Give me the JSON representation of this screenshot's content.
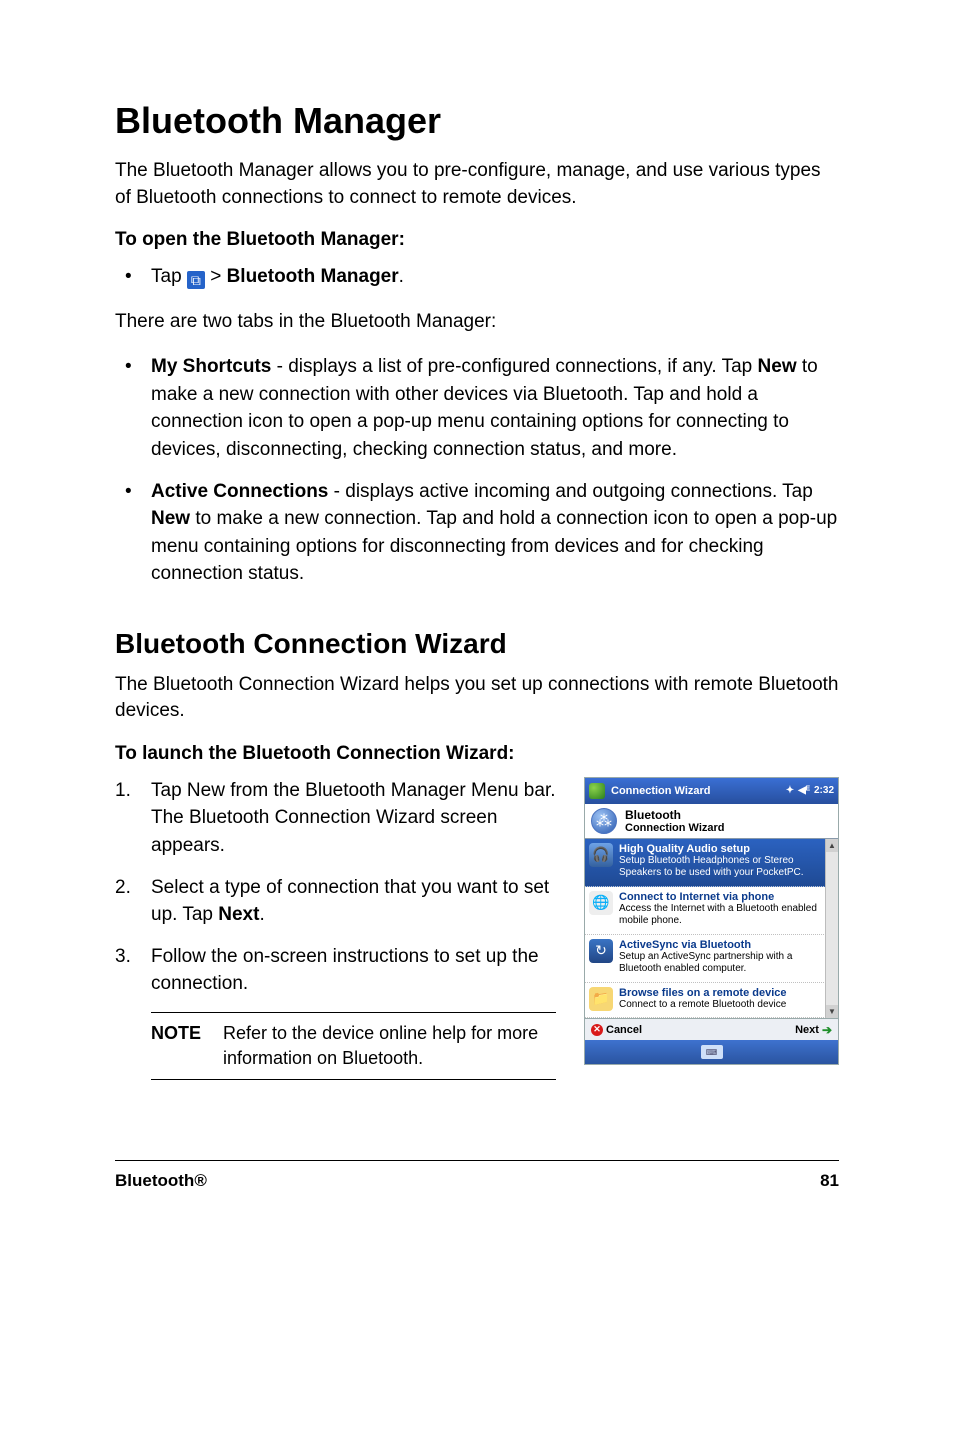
{
  "h1": "Bluetooth Manager",
  "intro1": "The Bluetooth Manager allows you to pre-configure, manage, and use various types of Bluetooth connections to connect to remote devices.",
  "open_head": "To open the Bluetooth Manager:",
  "open_step_pre": "Tap ",
  "open_step_post": " > ",
  "open_step_bold": "Bluetooth Manager",
  "open_step_period": ".",
  "two_tabs_intro": "There are two tabs in the Bluetooth Manager:",
  "tab1_bold": "My Shortcuts",
  "tab1_text_a": " - displays a list of pre-configured connections, if any. Tap ",
  "tab1_text_new": "New",
  "tab1_text_b": " to make a new connection with other devices via Bluetooth. Tap and hold a connection icon to open a pop-up menu containing options for connecting to devices, disconnecting, checking connection status, and more.",
  "tab2_bold": "Active Connections",
  "tab2_text_a": " - displays active incoming and outgoing connections. Tap ",
  "tab2_text_new": "New",
  "tab2_text_b": " to make a new connection. Tap and hold a connection icon to open a pop-up menu containing options for disconnecting from devices and for checking connection status.",
  "h2": "Bluetooth Connection Wizard",
  "intro2": "The Bluetooth Connection Wizard helps you set up connections with remote Bluetooth devices.",
  "launch_head": "To launch the Bluetooth Connection Wizard:",
  "step1": "Tap New from the Bluetooth Manager Menu bar. The Bluetooth Connection Wizard screen appears.",
  "step2_a": "Select a type of connection that you want to set up. Tap ",
  "step2_next": "Next",
  "step2_b": ".",
  "step3": "Follow the on-screen instructions to set up the connection.",
  "note_label": "NOTE",
  "note_body": "Refer to the device online help for more information on Bluetooth.",
  "footer_left": "Bluetooth®",
  "footer_right": "81",
  "device": {
    "titlebar": "Connection Wizard",
    "time": "2:32",
    "header1": "Bluetooth",
    "header2": "Connection Wizard",
    "items": [
      {
        "icon": "audio",
        "t1": "High Quality Audio setup",
        "t2": "Setup Bluetooth Headphones or Stereo Speakers to be used with your PocketPC.",
        "selected": true
      },
      {
        "icon": "globe",
        "t1": "Connect to Internet via phone",
        "t2": "Access the Internet with a Bluetooth enabled mobile phone.",
        "selected": false
      },
      {
        "icon": "sync",
        "t1": "ActiveSync via Bluetooth",
        "t2": "Setup an ActiveSync partnership with a Bluetooth enabled computer.",
        "selected": false
      },
      {
        "icon": "folder",
        "t1": "Browse files on a remote device",
        "t2": "Connect to a remote Bluetooth device",
        "selected": false
      }
    ],
    "cancel": "Cancel",
    "next": "Next"
  }
}
